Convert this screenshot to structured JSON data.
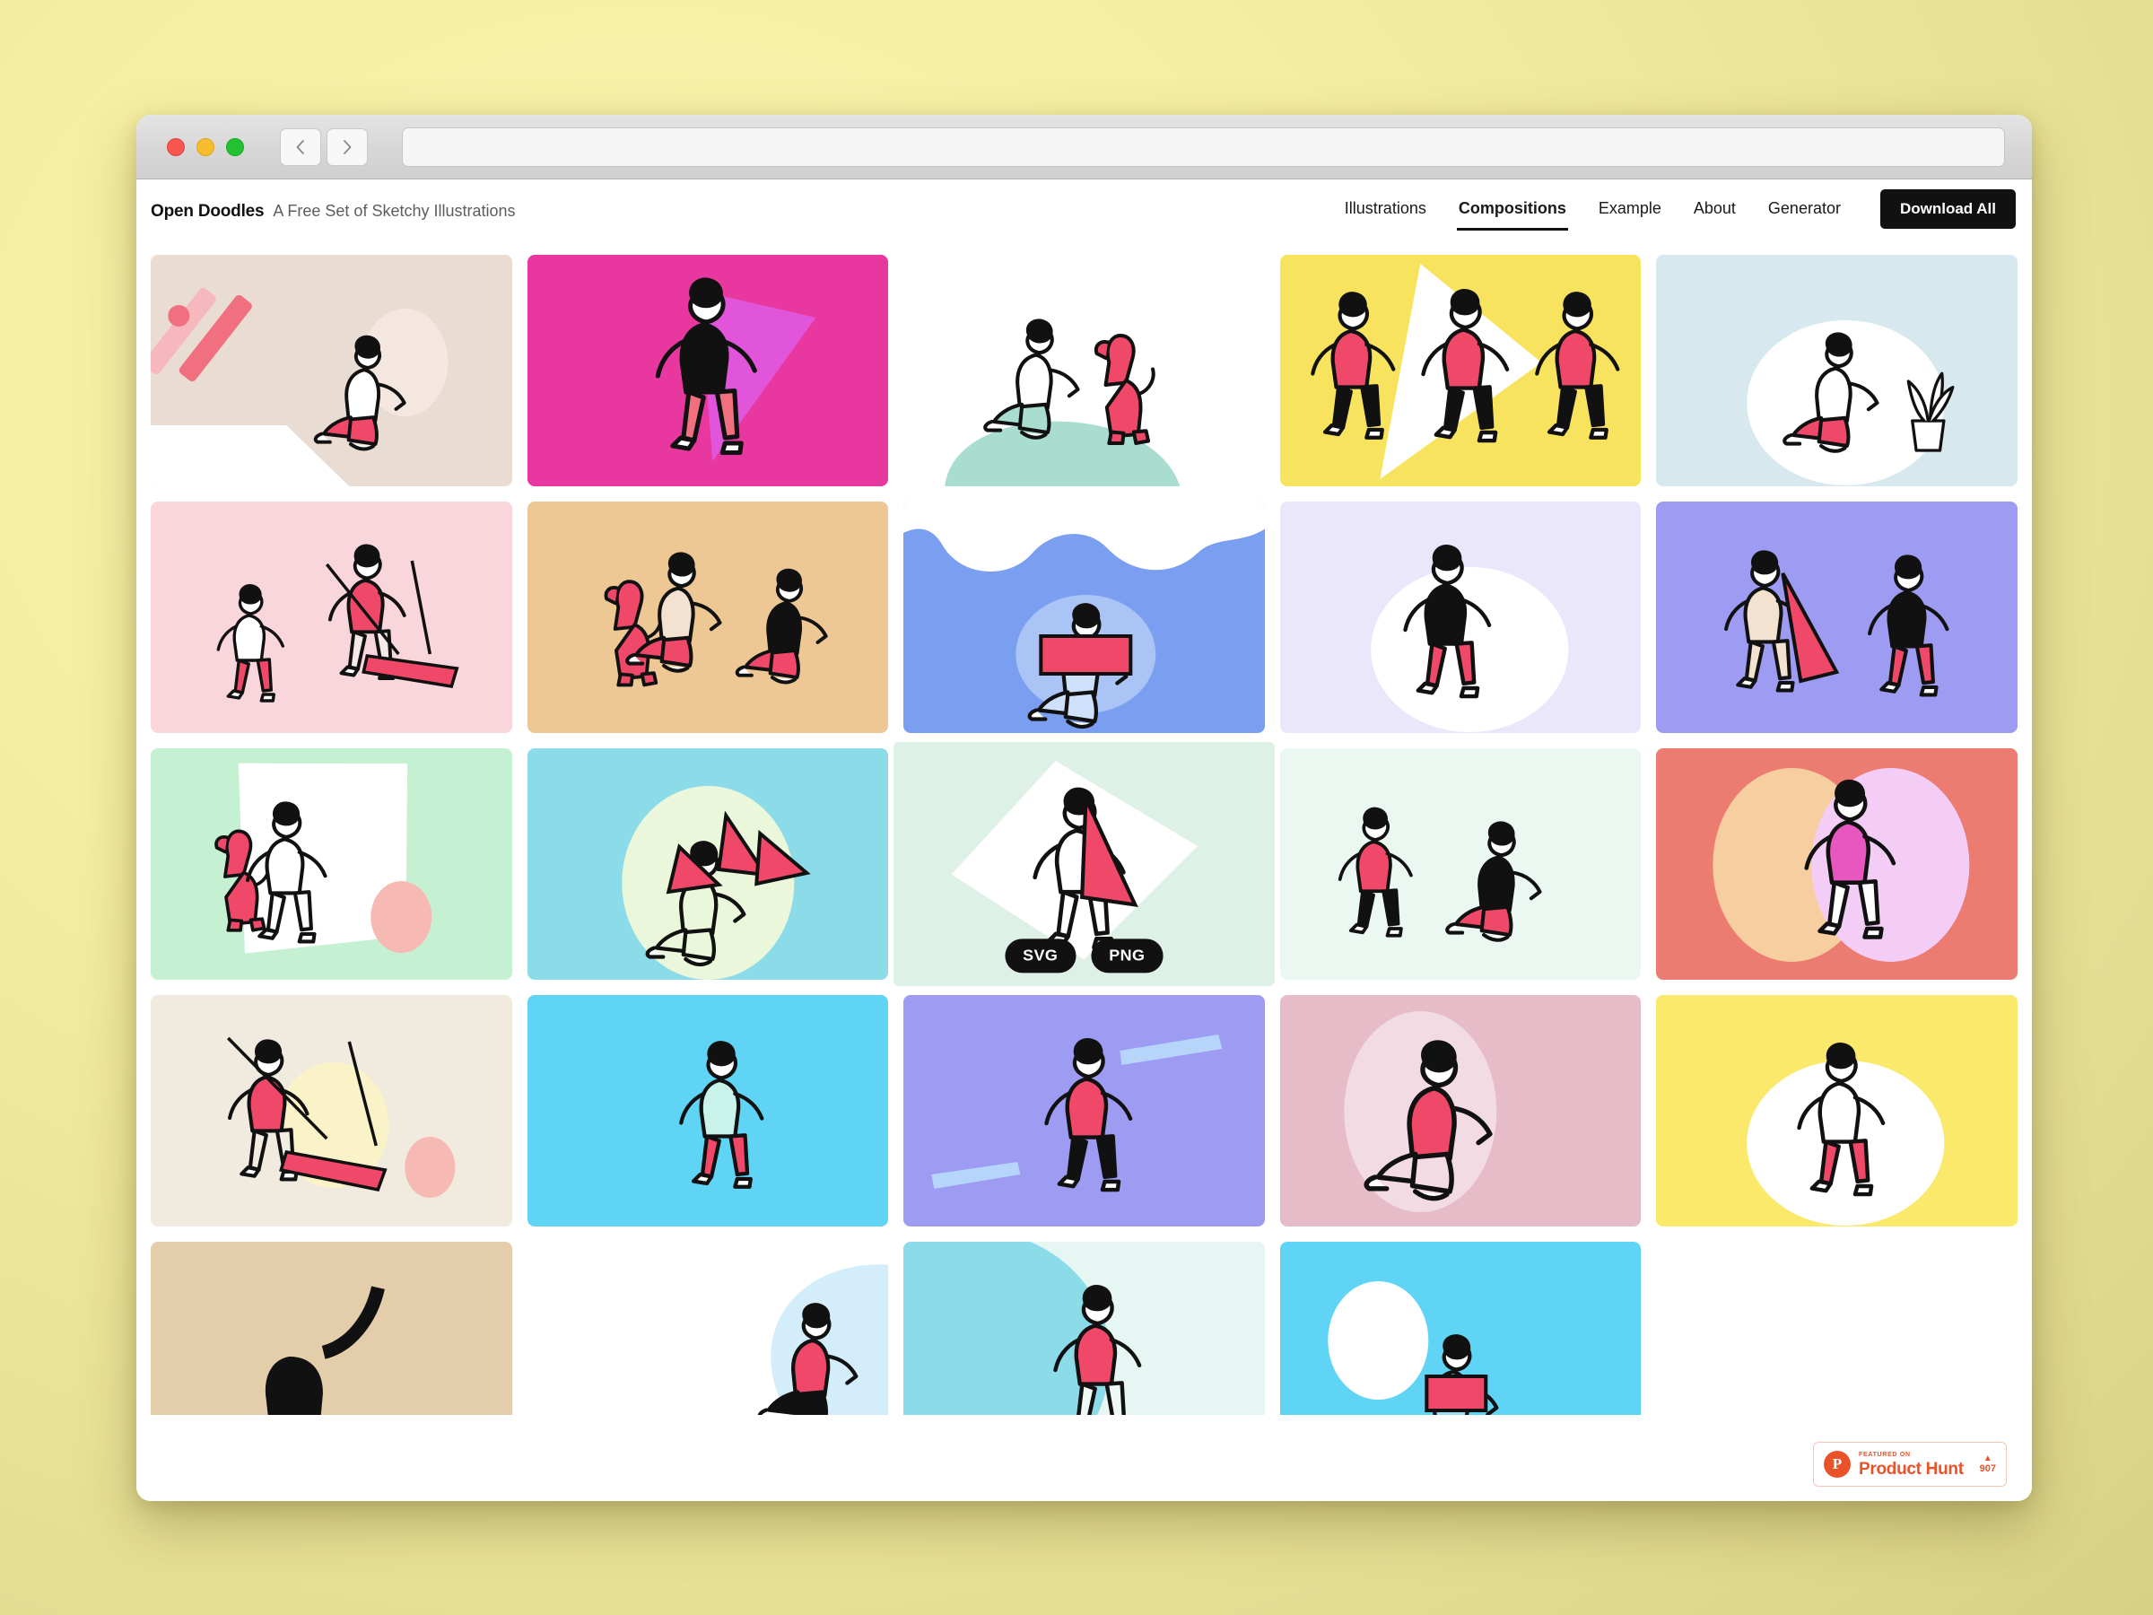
{
  "browser": {
    "traffic_lights": [
      "close",
      "minimize",
      "zoom"
    ],
    "back_label": "‹",
    "forward_label": "›",
    "url_value": "",
    "url_placeholder": ""
  },
  "header": {
    "brand_name": "Open Doodles",
    "brand_tagline": "A Free Set of Sketchy Illustrations",
    "nav": [
      {
        "label": "Illustrations",
        "active": false
      },
      {
        "label": "Compositions",
        "active": true
      },
      {
        "label": "Example",
        "active": false
      },
      {
        "label": "About",
        "active": false
      },
      {
        "label": "Generator",
        "active": false
      }
    ],
    "download_all_label": "Download All"
  },
  "hover_actions": {
    "svg_label": "SVG",
    "png_label": "PNG",
    "hovered_index": 12
  },
  "colors": {
    "page_background": "#f5eda0",
    "accent_pink": "#ef4868",
    "ink": "#111111",
    "nav_active_underline": "#111111",
    "download_button_bg": "#111111",
    "product_hunt": "#ea532a"
  },
  "gallery": [
    {
      "name": "sitting-reading-beige",
      "bg": "#e9dcd3",
      "shapes": "stripes-white-card",
      "accent": "#f2a0a8"
    },
    {
      "name": "dancing-magenta",
      "bg": "#e8389f",
      "shapes": "violet-triangle",
      "accent": "#d44de0"
    },
    {
      "name": "petting-dog-white",
      "bg": "#ffffff",
      "shapes": "mint-arc",
      "accent": "#a8ddd0"
    },
    {
      "name": "running-trio-yellow",
      "bg": "#f8e35e",
      "shapes": "white-triangle",
      "accent": "#ffffff"
    },
    {
      "name": "reading-plant-lightblue",
      "bg": "#d7e9ef",
      "shapes": "white-blob",
      "accent": "#ffffff"
    },
    {
      "name": "swing-pair-pink",
      "bg": "#f9d5dc",
      "shapes": "none",
      "accent": "#ef4868"
    },
    {
      "name": "dog-and-sitters-tan",
      "bg": "#edc894",
      "shapes": "none",
      "accent": "#ef4868"
    },
    {
      "name": "reading-clouds-blue",
      "bg": "#7a9ff0",
      "shapes": "white-clouds",
      "accent": "#ef4868"
    },
    {
      "name": "selfie-lavender",
      "bg": "#eae7fb",
      "shapes": "white-blob",
      "accent": "#ef4868"
    },
    {
      "name": "duo-selfie-periwinkle",
      "bg": "#9d9bf2",
      "shapes": "none",
      "accent": "#ef4868"
    },
    {
      "name": "dog-walk-mint",
      "bg": "#c6f0d2",
      "shapes": "white-card-pink-circle",
      "accent": "#f6b9b4"
    },
    {
      "name": "holding-plant-cyan",
      "bg": "#8cdbe9",
      "shapes": "pale-blob",
      "accent": "#ef4868"
    },
    {
      "name": "flag-runner-mint",
      "bg": "#ddf1e6",
      "shapes": "white-diamond",
      "accent": "#ef4868"
    },
    {
      "name": "helping-up-paleaqua",
      "bg": "#ebf8f2",
      "shapes": "none",
      "accent": "#ef4868"
    },
    {
      "name": "papers-flying-coral",
      "bg": "#ec7b72",
      "shapes": "peach-and-lilac-circles",
      "accent": "#e857c0"
    },
    {
      "name": "swing-solo-cream",
      "bg": "#f0eadf",
      "shapes": "cream-circle-pink-dot",
      "accent": "#ef4868"
    },
    {
      "name": "walking-bag-cyan",
      "bg": "#5fd4f5",
      "shapes": "angled-cut",
      "accent": "#ef4868"
    },
    {
      "name": "leaping-periwinkle",
      "bg": "#9d9bf2",
      "shapes": "light-streaks",
      "accent": "#ef4868"
    },
    {
      "name": "long-hair-rose",
      "bg": "#e5bcc8",
      "shapes": "pale-ellipse",
      "accent": "#ef4868"
    },
    {
      "name": "kicking-yellow",
      "bg": "#fae96a",
      "shapes": "white-blob",
      "accent": "#ef4868"
    },
    {
      "name": "hi-selfie-tan",
      "bg": "#e3cdab",
      "shapes": "none",
      "accent": "#111111"
    },
    {
      "name": "chair-books-white",
      "bg": "#ffffff",
      "shapes": "lightblue-blob",
      "accent": "#ef4868"
    },
    {
      "name": "skating-lightcyan",
      "bg": "#8cdbe9",
      "shapes": "pale-mint-curve",
      "accent": "#ef4868"
    },
    {
      "name": "reading-sun-cyan",
      "bg": "#5fd4f5",
      "shapes": "white-circle",
      "accent": "#ef4868"
    },
    {
      "name": "empty-slot",
      "bg": "#ffffff",
      "shapes": "none",
      "accent": "#ffffff"
    }
  ],
  "footer": {
    "product_hunt": {
      "featured_label": "FEATURED ON",
      "name_label": "Product Hunt",
      "vote_count": "907",
      "caret": "▲"
    }
  }
}
